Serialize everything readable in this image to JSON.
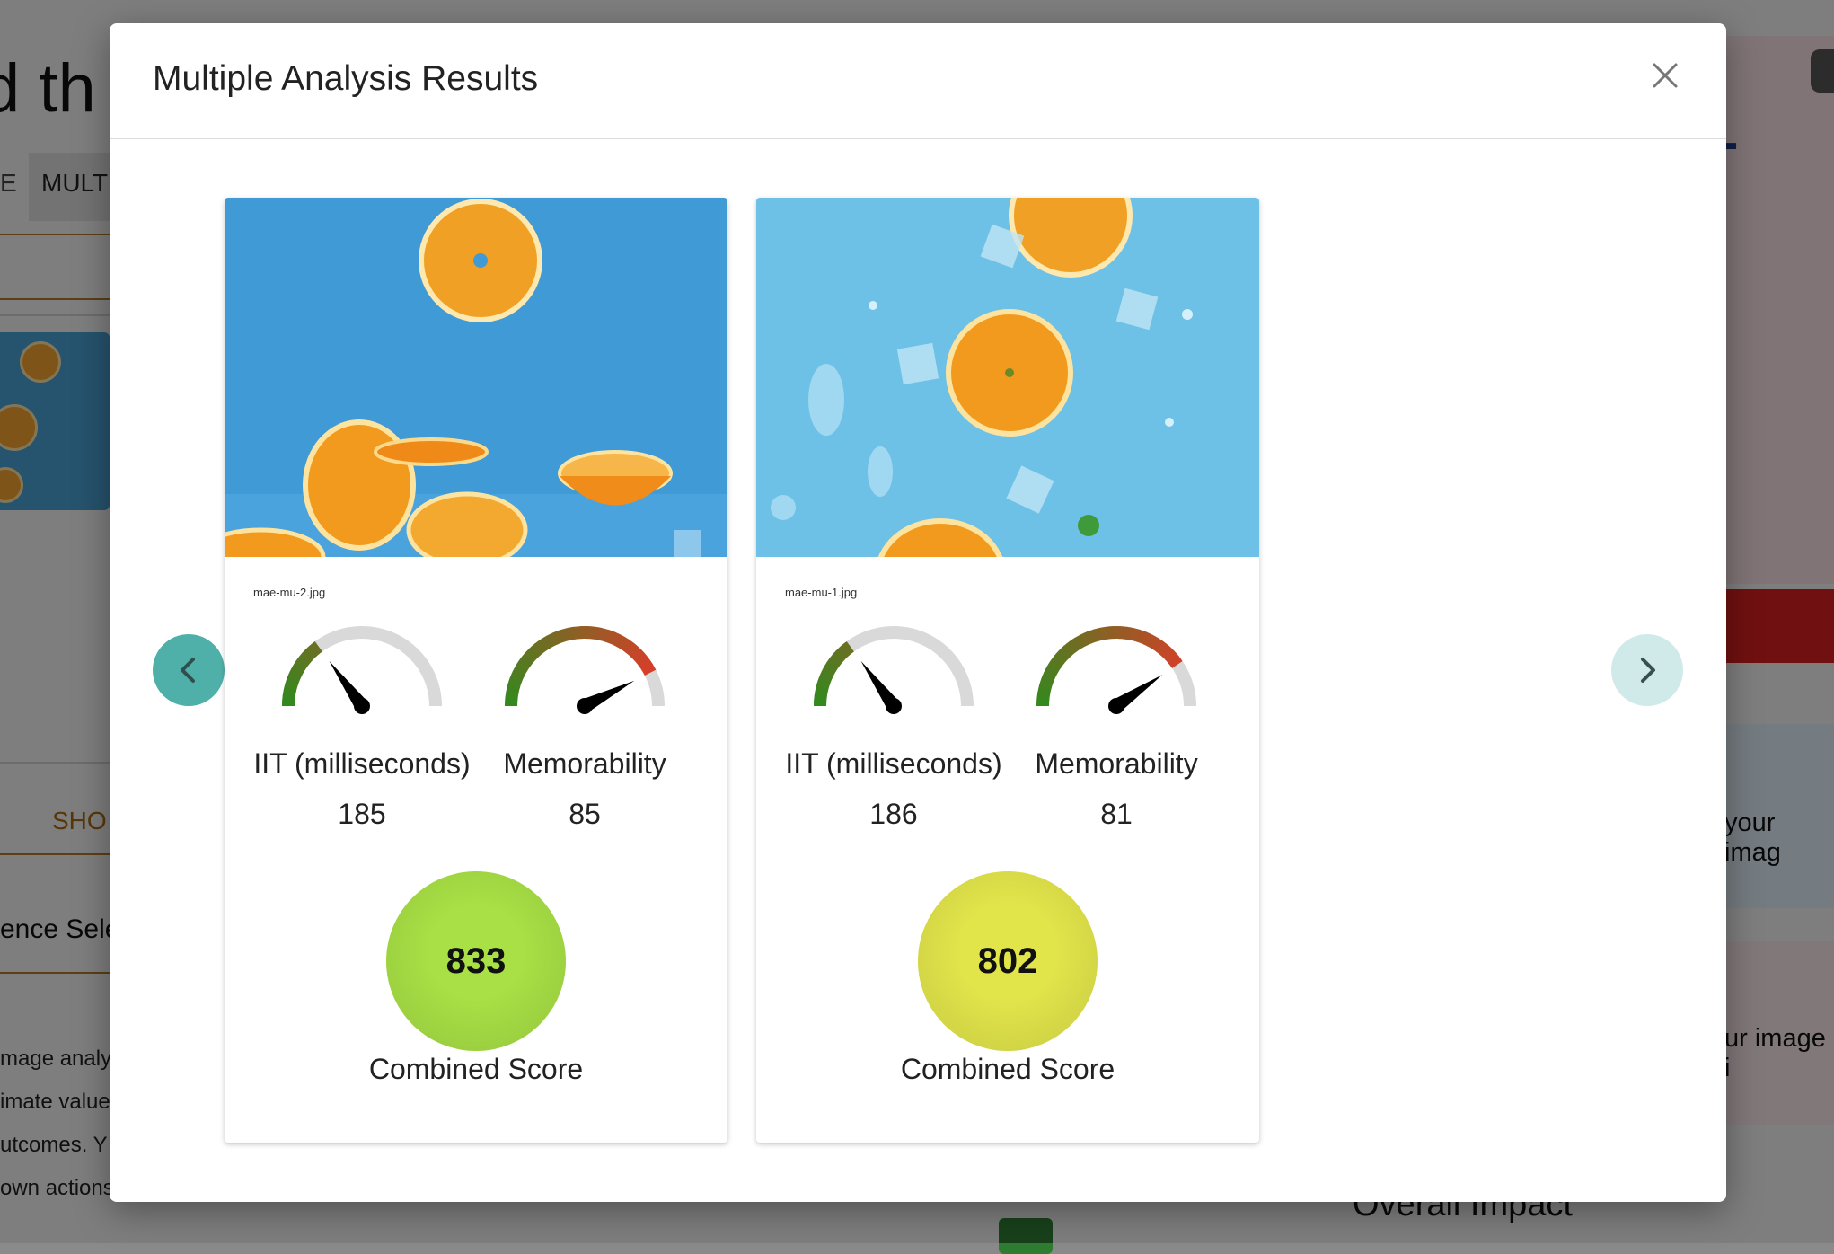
{
  "modal": {
    "title": "Multiple Analysis Results",
    "close_icon": "close-icon",
    "prev_icon": "chevron-left-icon",
    "next_icon": "chevron-right-icon"
  },
  "results": [
    {
      "filename": "mae-mu-2.jpg",
      "iit_label": "IIT (milliseconds)",
      "iit_value": "185",
      "iit_level": 0.3,
      "mem_label": "Memorability",
      "mem_value": "85",
      "mem_level": 0.85,
      "score": "833",
      "score_label": "Combined Score",
      "score_color": "#a8e045"
    },
    {
      "filename": "mae-mu-1.jpg",
      "iit_label": "IIT (milliseconds)",
      "iit_value": "186",
      "iit_level": 0.3,
      "mem_label": "Memorability",
      "mem_value": "81",
      "mem_level": 0.81,
      "score": "802",
      "score_label": "Combined Score",
      "score_color": "#e2e54a"
    }
  ],
  "background": {
    "heading_fragment": "d th",
    "tab_a": "E",
    "tab_b": "MULT",
    "show_button": "SHO",
    "select_text": "ence Sele",
    "text_lines": [
      "mage analy",
      "imate value",
      "utcomes. Y",
      "own actions"
    ],
    "right_text_1": "your imag",
    "right_text_2": "ur image i",
    "right_letter": "L",
    "overall": "Overall Impact"
  },
  "colors": {
    "gauge_track": "#d9d9d9",
    "gauge_good": "#2e8b1e",
    "gauge_bad": "#e03a2a",
    "nav_prev": "#4fb0aa",
    "nav_next": "#cfeae9"
  }
}
